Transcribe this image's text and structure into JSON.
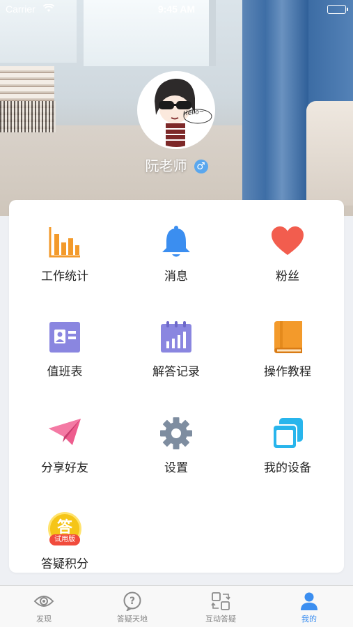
{
  "status_bar": {
    "carrier": "Carrier",
    "time": "9:45 AM"
  },
  "profile": {
    "name": "阮老师",
    "gender_symbol": "♂",
    "avatar_caption": "Hello~"
  },
  "menu": {
    "work_stats": "工作统计",
    "messages": "消息",
    "fans": "粉丝",
    "duty_schedule": "值班表",
    "answer_records": "解答记录",
    "tutorial": "操作教程",
    "share_friends": "分享好友",
    "settings": "设置",
    "my_devices": "我的设备",
    "qa_points": "答疑积分",
    "qa_points_icon_char": "答",
    "qa_points_badge": "试用版"
  },
  "tabbar": {
    "discover": "发现",
    "qa_world": "答疑天地",
    "interactive_qa": "互动答疑",
    "mine": "我的"
  },
  "colors": {
    "accent": "#3b8ef0",
    "orange": "#f39a2b",
    "blue": "#3b8ef0",
    "red": "#f25d4e",
    "purple": "#8a86e0",
    "pink": "#ee5d8e",
    "gray": "#7e8da0",
    "cyan": "#28b5ec",
    "yellow": "#f5c518"
  }
}
